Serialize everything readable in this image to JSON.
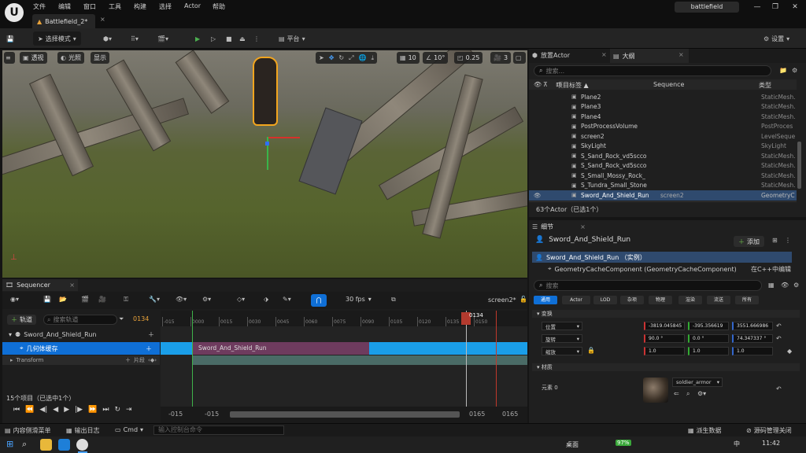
{
  "menu": {
    "items": [
      "文件",
      "编辑",
      "窗口",
      "工具",
      "构建",
      "选择",
      "Actor",
      "帮助"
    ]
  },
  "document_tab": {
    "label": "Battlefield_2*"
  },
  "project": {
    "name": "battlefield"
  },
  "toolbar": {
    "mode_label": "选择模式",
    "platform_label": "平台",
    "settings_label": "设置"
  },
  "viewport": {
    "perspective_label": "透视",
    "lit_label": "光照",
    "show_label": "显示",
    "grid_value": "10",
    "angle_value": "10°",
    "scale_value": "0.25",
    "camera_speed": "3"
  },
  "outliner": {
    "tabs": [
      "放置Actor",
      "大纲"
    ],
    "search_placeholder": "搜索...",
    "columns": {
      "label": "项目标签 ▲",
      "sequence": "Sequence",
      "type": "类型"
    },
    "rows": [
      {
        "name": "Plane2",
        "seq": "",
        "type": "StaticMesh."
      },
      {
        "name": "Plane3",
        "seq": "",
        "type": "StaticMesh."
      },
      {
        "name": "Plane4",
        "seq": "",
        "type": "StaticMesh."
      },
      {
        "name": "PostProcessVolume",
        "seq": "",
        "type": "PostProces"
      },
      {
        "name": "screen2",
        "seq": "",
        "type": "LevelSeque"
      },
      {
        "name": "SkyLight",
        "seq": "",
        "type": "SkyLight"
      },
      {
        "name": "S_Sand_Rock_vd5scco",
        "seq": "",
        "type": "StaticMesh."
      },
      {
        "name": "S_Sand_Rock_vd5scco",
        "seq": "",
        "type": "StaticMesh."
      },
      {
        "name": "S_Small_Mossy_Rock_",
        "seq": "",
        "type": "StaticMesh."
      },
      {
        "name": "S_Tundra_Small_Stone",
        "seq": "",
        "type": "StaticMesh."
      },
      {
        "name": "Sword_And_Shield_Run",
        "seq": "screen2",
        "type": "GeometryC"
      }
    ],
    "count_text": "63个Actor（已选1个）"
  },
  "details": {
    "tab_label": "细节",
    "actor_name": "Sword_And_Shield_Run",
    "add_label": "添加",
    "instance_label": "Sword_And_Shield_Run （实例）",
    "component_label": "GeometryCacheComponent (GeometryCacheComponent)",
    "edit_in_cpp": "在C++中编辑",
    "search_placeholder": "搜索",
    "filters": [
      "通用",
      "Actor",
      "LOD",
      "杂项",
      "物理",
      "渲染",
      "流送",
      "所有"
    ],
    "transform_header": "变换",
    "location_label": "位置",
    "rotation_label": "旋转",
    "scale_label": "缩放",
    "location": [
      "-3819.045845",
      "-395.356619",
      "3551.666986"
    ],
    "rotation": [
      "90.0 °",
      "0.0 °",
      "74.347337 °"
    ],
    "scale": [
      "1.0",
      "1.0",
      "1.0"
    ],
    "materials_header": "材质",
    "element_label": "元素 0",
    "material_name": "soldier_armor"
  },
  "sequencer": {
    "tab_label": "Sequencer",
    "fps_label": "30 fps",
    "sequence_name": "screen2*",
    "add_track_label": "轨道",
    "search_placeholder": "搜索轨道",
    "current_frame": "0134",
    "tracks": {
      "root": "Sword_And_Shield_Run",
      "geo_cache": "几何体缓存",
      "transform": "Transform",
      "section_label": "片段"
    },
    "ruler_ticks": [
      "-015",
      "0000",
      "0015",
      "0030",
      "0045",
      "0060",
      "0075",
      "0090",
      "0105",
      "0120",
      "0135",
      "0150"
    ],
    "clip_label": "Sword_And_Shield_Run",
    "item_count": "15个项目（已选中1个）",
    "range_start": "-015",
    "range_start2": "-015",
    "range_end": "0165",
    "range_end2": "0165"
  },
  "statusbar": {
    "content_drawer": "内容侧滑菜单",
    "output_log": "输出日志",
    "cmd_label": "Cmd",
    "cmd_placeholder": "输入控制台命令",
    "derived_data": "派生数据",
    "source_control": "源码管理关闭"
  },
  "taskbar": {
    "desktop_label": "桌面",
    "battery": "97%",
    "ime": "中",
    "clock": "11:42"
  },
  "colors": {
    "accent": "#0f6fd6",
    "selection": "#2f4a6e",
    "clip": "#1a9ee8"
  }
}
